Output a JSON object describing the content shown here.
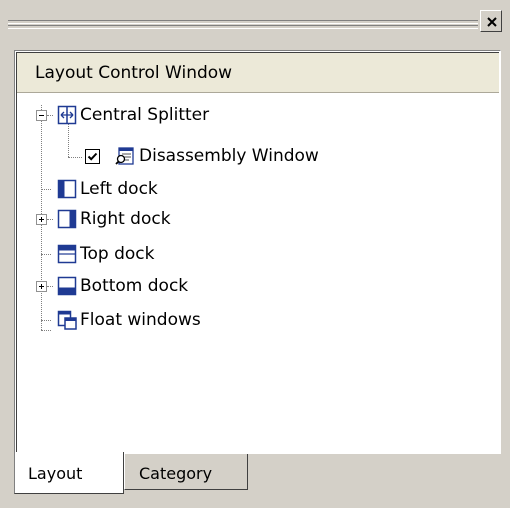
{
  "window": {
    "close_label": "×"
  },
  "panel": {
    "title": "Layout Control Window"
  },
  "tree": {
    "nodes": [
      {
        "label": "Central Splitter",
        "expander": "minus",
        "icon": "splitter-icon"
      },
      {
        "label": "Disassembly Window",
        "checked": true,
        "icon": "disassembly-window-icon"
      },
      {
        "label": "Left dock",
        "icon": "left-dock-icon"
      },
      {
        "label": "Right dock",
        "expander": "plus",
        "icon": "right-dock-icon"
      },
      {
        "label": "Top dock",
        "icon": "top-dock-icon"
      },
      {
        "label": "Bottom dock",
        "expander": "plus",
        "icon": "bottom-dock-icon"
      },
      {
        "label": "Float windows",
        "icon": "float-windows-icon"
      }
    ]
  },
  "tabs": [
    {
      "label": "Layout",
      "active": true
    },
    {
      "label": "Category",
      "active": false
    }
  ],
  "colors": {
    "chrome": "#d4d0c8",
    "header": "#ece9d8",
    "icon_blue": "#1f3a93"
  }
}
